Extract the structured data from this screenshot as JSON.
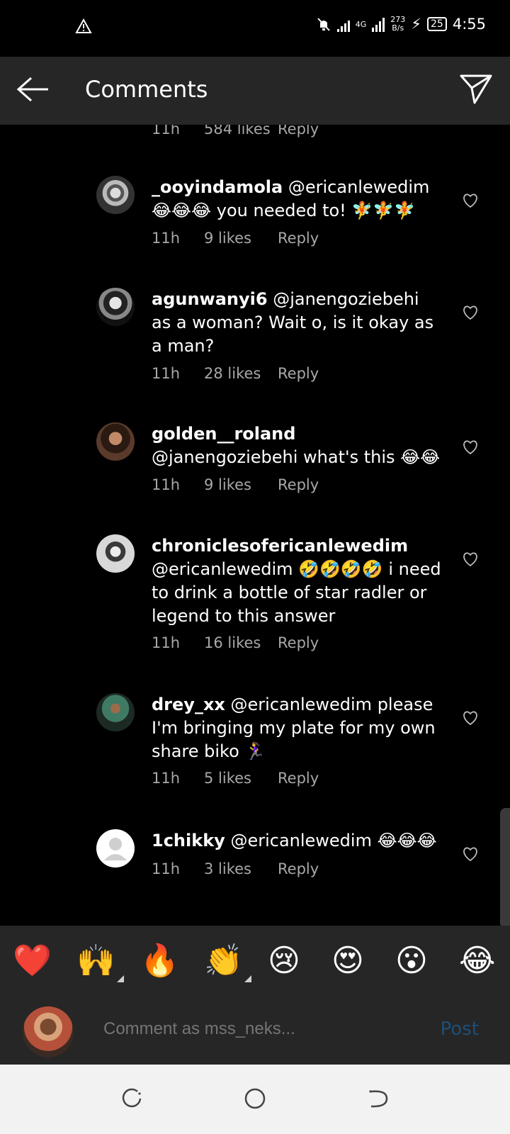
{
  "status_bar": {
    "network": "4G",
    "speed_value": "273",
    "speed_unit": "B/s",
    "battery": "25",
    "time": "4:55"
  },
  "header": {
    "title": "Comments"
  },
  "top_meta": {
    "time": "11h",
    "likes": "584 likes",
    "reply": "Reply"
  },
  "comments": [
    {
      "username": "_ooyindamola",
      "text": " @ericanlewedim 😂😂😂 you needed to! 🧚🧚🧚",
      "time": "11h",
      "likes": "9 likes",
      "reply": "Reply"
    },
    {
      "username": "agunwanyi6",
      "text": " @janengoziebehi as a woman? Wait o, is it okay as a man?",
      "time": "11h",
      "likes": "28 likes",
      "reply": "Reply"
    },
    {
      "username": "golden__roland",
      "text": " @janengoziebehi what's this 😂😂",
      "time": "11h",
      "likes": "9 likes",
      "reply": "Reply"
    },
    {
      "username": "chroniclesofericanlewedim",
      "text": " @ericanlewedim 🤣🤣🤣🤣 i need to drink a bottle of star radler or legend to this answer",
      "time": "11h",
      "likes": "16 likes",
      "reply": "Reply"
    },
    {
      "username": "drey_xx",
      "text": " @ericanlewedim please I'm bringing my plate for my own share biko 🏃‍♀️",
      "time": "11h",
      "likes": "5 likes",
      "reply": "Reply"
    },
    {
      "username": "1chikky",
      "text": " @ericanlewedim 😂😂😂",
      "time": "11h",
      "likes": "3 likes",
      "reply": "Reply"
    }
  ],
  "emoji_bar": [
    "❤️",
    "🙌",
    "🔥",
    "👏",
    "😢",
    "😍",
    "😮",
    "😂"
  ],
  "comment_input": {
    "placeholder": "Comment as mss_neks...",
    "post_label": "Post"
  },
  "colors": {
    "header_bg": "#262626",
    "post_disabled": "#1d4f7a",
    "meta_text": "#a8a8a8"
  }
}
